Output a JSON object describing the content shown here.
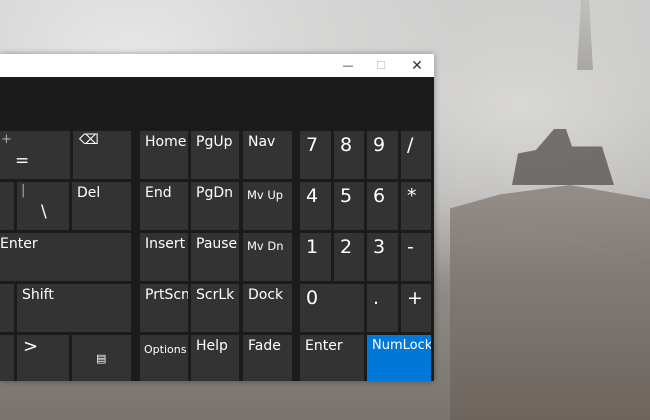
{
  "window": {
    "buttons": {
      "minimize": "—",
      "maximize": "☐",
      "close": "✕"
    }
  },
  "keys": {
    "plus": "+",
    "equals": "=",
    "backspace_icon": "⌫",
    "backslash_bar": "|",
    "backslash": "\\",
    "del": "Del",
    "enter": "Enter",
    "shift": "Shift",
    "chevron": ">",
    "menu_icon": "▤",
    "home": "Home",
    "pgup": "PgUp",
    "nav": "Nav",
    "end": "End",
    "pgdn": "PgDn",
    "mvup": "Mv Up",
    "insert": "Insert",
    "pause": "Pause",
    "mvdn": "Mv Dn",
    "prtscn": "PrtScn",
    "scrlk": "ScrLk",
    "dock": "Dock",
    "options": "Options",
    "help": "Help",
    "fade": "Fade",
    "num7": "7",
    "num8": "8",
    "num9": "9",
    "slash": "/",
    "num4": "4",
    "num5": "5",
    "num6": "6",
    "star": "*",
    "num1": "1",
    "num2": "2",
    "num3": "3",
    "minus": "-",
    "num0": "0",
    "dot": ".",
    "numplus": "+",
    "numenter": "Enter",
    "numlock": "NumLock"
  },
  "colors": {
    "key": "#333333",
    "active": "#0078d7",
    "bg": "#1b1b1b"
  }
}
